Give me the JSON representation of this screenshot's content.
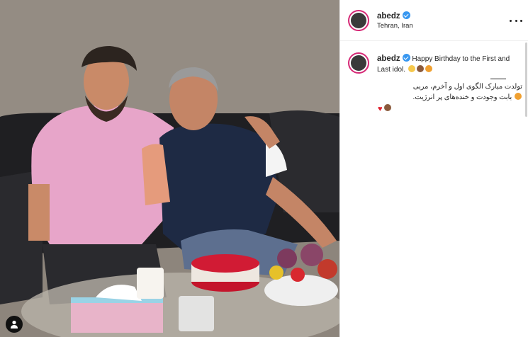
{
  "post": {
    "username": "abedz",
    "location": "Tehran, Iran",
    "more_icon": "more-horizontal-icon",
    "verified_icon": "verified-badge-icon"
  },
  "caption": {
    "username": "abedz",
    "english": "Happy Birthday to the First and Last idol.",
    "persian_line1": "تولدت مبارک الگوی اول و آخرم، مربی",
    "persian_line2": "بابت وجودت و خنده‌های پر انرژیت.",
    "heart": "♥"
  },
  "photo": {
    "tag_icon": "user-tag-icon"
  }
}
